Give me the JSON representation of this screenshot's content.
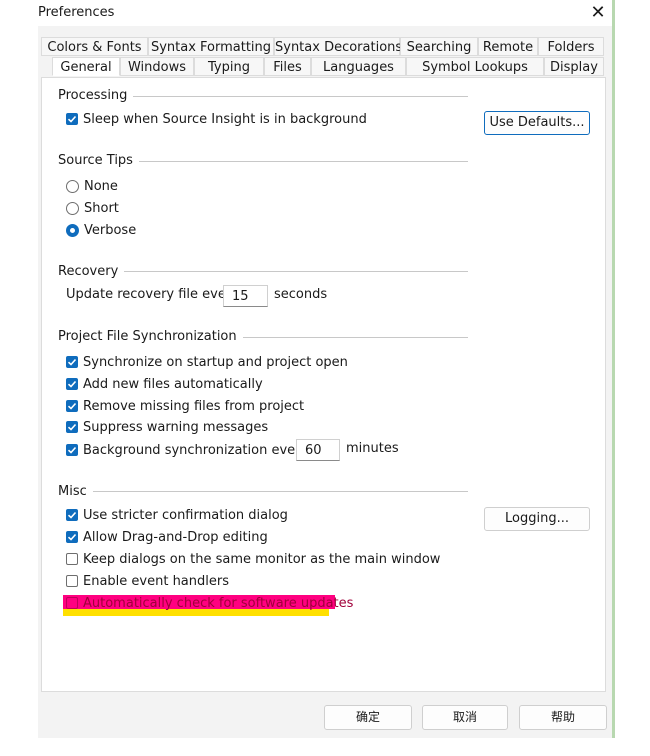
{
  "window": {
    "title": "Preferences"
  },
  "tabs_row1": [
    "Colors & Fonts",
    "Syntax Formatting",
    "Syntax Decorations",
    "Searching",
    "Remote",
    "Folders"
  ],
  "tabs_row2": [
    "General",
    "Windows",
    "Typing",
    "Files",
    "Languages",
    "Symbol Lookups",
    "Display"
  ],
  "active_tab": "General",
  "processing": {
    "label": "Processing",
    "sleep": {
      "label": "Sleep when Source Insight is in background",
      "checked": true
    },
    "use_defaults": "Use Defaults..."
  },
  "source_tips": {
    "label": "Source Tips",
    "options": [
      {
        "label": "None",
        "checked": false
      },
      {
        "label": "Short",
        "checked": false
      },
      {
        "label": "Verbose",
        "checked": true
      }
    ]
  },
  "recovery": {
    "label": "Recovery",
    "prefix": "Update recovery file every",
    "value": "15",
    "suffix": "seconds"
  },
  "project_sync": {
    "label": "Project File Synchronization",
    "items": [
      {
        "label": "Synchronize on startup and project open",
        "checked": true
      },
      {
        "label": "Add new files automatically",
        "checked": true
      },
      {
        "label": "Remove missing files from project",
        "checked": true
      },
      {
        "label": "Suppress warning messages",
        "checked": true
      }
    ],
    "background": {
      "label": "Background synchronization every",
      "checked": true,
      "value": "60",
      "suffix": "minutes"
    }
  },
  "misc": {
    "label": "Misc",
    "items": [
      {
        "label": "Use stricter confirmation dialog",
        "checked": true
      },
      {
        "label": "Allow Drag-and-Drop editing",
        "checked": true
      },
      {
        "label": "Keep dialogs on the same monitor as the main window",
        "checked": false
      },
      {
        "label": "Enable event handlers",
        "checked": false
      },
      {
        "label": "Automatically check for software updates",
        "checked": false
      }
    ],
    "logging": "Logging..."
  },
  "footer": {
    "ok": "确定",
    "cancel": "取消",
    "help": "帮助"
  },
  "colors": {
    "accent": "#0f6cbd",
    "highlight_pink": "#ff0080",
    "highlight_yellow": "#ffe000"
  }
}
